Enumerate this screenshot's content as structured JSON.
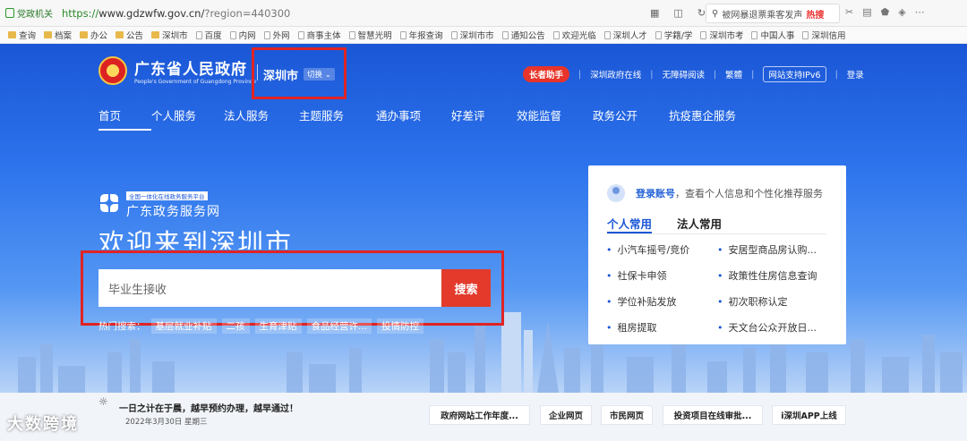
{
  "browser": {
    "site_badge": "党政机关",
    "url_proto": "https://",
    "url_host": "www.gdzwfw.gov.cn/",
    "url_query": "?region=440300",
    "search_text": "被网暴退票乘客发声",
    "search_hot": "热搜"
  },
  "bookmarks": [
    "查询",
    "档案",
    "办公",
    "公告",
    "深圳市",
    "百度",
    "内网",
    "外网",
    "商事主体",
    "智慧光明",
    "年报查询",
    "深圳市市",
    "通知公告",
    "欢迎光临",
    "深圳人才",
    "学籍/学",
    "深圳市考",
    "中国人事",
    "深圳信用"
  ],
  "header": {
    "gov_name": "广东省人民政府",
    "gov_name_en": "People's Government of Guangdong Province",
    "city": "深圳市",
    "switch_label": "切换",
    "links": {
      "elder": "长者助手",
      "online": "深圳政府在线",
      "accessible": "无障碍阅读",
      "traditional": "繁體",
      "ipv6": "网站支持IPv6",
      "login": "登录"
    }
  },
  "nav": [
    "首页",
    "个人服务",
    "法人服务",
    "主题服务",
    "通办事项",
    "好差评",
    "效能监督",
    "政务公开",
    "抗疫惠企服务"
  ],
  "brand": {
    "badge": "全国一体化在线政务服务平台",
    "name": "广东政务服务网"
  },
  "welcome": "欢迎来到深圳市",
  "search": {
    "value": "毕业生接收",
    "button": "搜索",
    "hot_label": "热门搜索：",
    "hot_tags": [
      "基层就业补贴",
      "二孩",
      "生育津贴",
      "食品经营许...",
      "投情防控"
    ]
  },
  "panel": {
    "login_link": "登录账号",
    "login_text": "，查看个人信息和个性化推荐服务",
    "tab_personal": "个人常用",
    "tab_legal": "法人常用",
    "items": [
      "小汽车摇号/竞价",
      "安居型商品房认购...",
      "社保卡申领",
      "政策性住房信息查询",
      "学位补贴发放",
      "初次职称认定",
      "租房提取",
      "天文台公众开放日..."
    ]
  },
  "bottom": {
    "notice": "一日之计在于晨，越早预约办理，越早通过！",
    "date": "2022年3月30日 星期三",
    "buttons": [
      "政府网站工作年度...",
      "企业网页",
      "市民网页",
      "投资项目在线审批...",
      "i深圳APP上线"
    ]
  },
  "watermark": "大数跨境",
  "colors": {
    "primary": "#1a56d6",
    "search_btn": "#e33a2c",
    "highlight_box": "#e02424"
  }
}
